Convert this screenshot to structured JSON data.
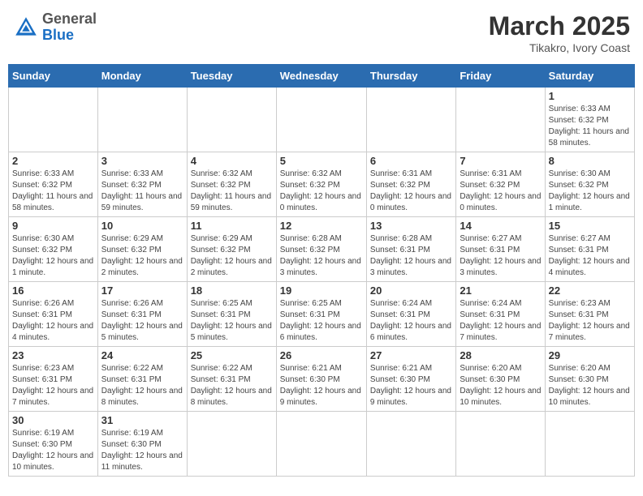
{
  "header": {
    "logo_general": "General",
    "logo_blue": "Blue",
    "month": "March 2025",
    "location": "Tikakro, Ivory Coast"
  },
  "weekdays": [
    "Sunday",
    "Monday",
    "Tuesday",
    "Wednesday",
    "Thursday",
    "Friday",
    "Saturday"
  ],
  "weeks": [
    [
      {
        "day": "",
        "info": ""
      },
      {
        "day": "",
        "info": ""
      },
      {
        "day": "",
        "info": ""
      },
      {
        "day": "",
        "info": ""
      },
      {
        "day": "",
        "info": ""
      },
      {
        "day": "",
        "info": ""
      },
      {
        "day": "1",
        "info": "Sunrise: 6:33 AM\nSunset: 6:32 PM\nDaylight: 11 hours and 58 minutes."
      }
    ],
    [
      {
        "day": "2",
        "info": "Sunrise: 6:33 AM\nSunset: 6:32 PM\nDaylight: 11 hours and 58 minutes."
      },
      {
        "day": "3",
        "info": "Sunrise: 6:33 AM\nSunset: 6:32 PM\nDaylight: 11 hours and 59 minutes."
      },
      {
        "day": "4",
        "info": "Sunrise: 6:32 AM\nSunset: 6:32 PM\nDaylight: 11 hours and 59 minutes."
      },
      {
        "day": "5",
        "info": "Sunrise: 6:32 AM\nSunset: 6:32 PM\nDaylight: 12 hours and 0 minutes."
      },
      {
        "day": "6",
        "info": "Sunrise: 6:31 AM\nSunset: 6:32 PM\nDaylight: 12 hours and 0 minutes."
      },
      {
        "day": "7",
        "info": "Sunrise: 6:31 AM\nSunset: 6:32 PM\nDaylight: 12 hours and 0 minutes."
      },
      {
        "day": "8",
        "info": "Sunrise: 6:30 AM\nSunset: 6:32 PM\nDaylight: 12 hours and 1 minute."
      }
    ],
    [
      {
        "day": "9",
        "info": "Sunrise: 6:30 AM\nSunset: 6:32 PM\nDaylight: 12 hours and 1 minute."
      },
      {
        "day": "10",
        "info": "Sunrise: 6:29 AM\nSunset: 6:32 PM\nDaylight: 12 hours and 2 minutes."
      },
      {
        "day": "11",
        "info": "Sunrise: 6:29 AM\nSunset: 6:32 PM\nDaylight: 12 hours and 2 minutes."
      },
      {
        "day": "12",
        "info": "Sunrise: 6:28 AM\nSunset: 6:32 PM\nDaylight: 12 hours and 3 minutes."
      },
      {
        "day": "13",
        "info": "Sunrise: 6:28 AM\nSunset: 6:31 PM\nDaylight: 12 hours and 3 minutes."
      },
      {
        "day": "14",
        "info": "Sunrise: 6:27 AM\nSunset: 6:31 PM\nDaylight: 12 hours and 3 minutes."
      },
      {
        "day": "15",
        "info": "Sunrise: 6:27 AM\nSunset: 6:31 PM\nDaylight: 12 hours and 4 minutes."
      }
    ],
    [
      {
        "day": "16",
        "info": "Sunrise: 6:26 AM\nSunset: 6:31 PM\nDaylight: 12 hours and 4 minutes."
      },
      {
        "day": "17",
        "info": "Sunrise: 6:26 AM\nSunset: 6:31 PM\nDaylight: 12 hours and 5 minutes."
      },
      {
        "day": "18",
        "info": "Sunrise: 6:25 AM\nSunset: 6:31 PM\nDaylight: 12 hours and 5 minutes."
      },
      {
        "day": "19",
        "info": "Sunrise: 6:25 AM\nSunset: 6:31 PM\nDaylight: 12 hours and 6 minutes."
      },
      {
        "day": "20",
        "info": "Sunrise: 6:24 AM\nSunset: 6:31 PM\nDaylight: 12 hours and 6 minutes."
      },
      {
        "day": "21",
        "info": "Sunrise: 6:24 AM\nSunset: 6:31 PM\nDaylight: 12 hours and 7 minutes."
      },
      {
        "day": "22",
        "info": "Sunrise: 6:23 AM\nSunset: 6:31 PM\nDaylight: 12 hours and 7 minutes."
      }
    ],
    [
      {
        "day": "23",
        "info": "Sunrise: 6:23 AM\nSunset: 6:31 PM\nDaylight: 12 hours and 7 minutes."
      },
      {
        "day": "24",
        "info": "Sunrise: 6:22 AM\nSunset: 6:31 PM\nDaylight: 12 hours and 8 minutes."
      },
      {
        "day": "25",
        "info": "Sunrise: 6:22 AM\nSunset: 6:31 PM\nDaylight: 12 hours and 8 minutes."
      },
      {
        "day": "26",
        "info": "Sunrise: 6:21 AM\nSunset: 6:30 PM\nDaylight: 12 hours and 9 minutes."
      },
      {
        "day": "27",
        "info": "Sunrise: 6:21 AM\nSunset: 6:30 PM\nDaylight: 12 hours and 9 minutes."
      },
      {
        "day": "28",
        "info": "Sunrise: 6:20 AM\nSunset: 6:30 PM\nDaylight: 12 hours and 10 minutes."
      },
      {
        "day": "29",
        "info": "Sunrise: 6:20 AM\nSunset: 6:30 PM\nDaylight: 12 hours and 10 minutes."
      }
    ],
    [
      {
        "day": "30",
        "info": "Sunrise: 6:19 AM\nSunset: 6:30 PM\nDaylight: 12 hours and 10 minutes."
      },
      {
        "day": "31",
        "info": "Sunrise: 6:19 AM\nSunset: 6:30 PM\nDaylight: 12 hours and 11 minutes."
      },
      {
        "day": "",
        "info": ""
      },
      {
        "day": "",
        "info": ""
      },
      {
        "day": "",
        "info": ""
      },
      {
        "day": "",
        "info": ""
      },
      {
        "day": "",
        "info": ""
      }
    ]
  ]
}
